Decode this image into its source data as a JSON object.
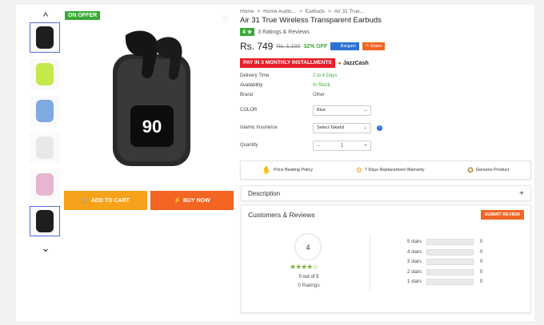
{
  "badge": "ON OFFER",
  "breadcrumb": [
    "Home",
    ">",
    "Home Audio...",
    ">",
    "Earbuds",
    ">",
    "Air 31 True..."
  ],
  "title": "Air 31 True Wireless Transparent Earbuds",
  "rating": {
    "score": "4",
    "star": "★",
    "text": "3 Ratings & Reviews"
  },
  "price": {
    "current": "Rs. 749",
    "old": "Rs. 1,100",
    "discount": "32% OFF"
  },
  "buttons": {
    "bargain": "Bargain",
    "share": "Share",
    "add_to_cart": "ADD TO CART",
    "buy_now": "BUY NOW",
    "submit_review": "SUBMIT REVIEW"
  },
  "installments": {
    "label": "PAY IN 3 MONTHLY INSTALLMENTS",
    "provider": "JazzCash"
  },
  "specs": [
    {
      "key": "Delivery Time",
      "value": "2 to 4 Days"
    },
    {
      "key": "Availability",
      "value": "In Stock"
    },
    {
      "key": "Brand",
      "value": "Other"
    }
  ],
  "fields": {
    "color_label": "COLOR",
    "color_value": "Blue",
    "insurance_label": "Islamic Insurance",
    "insurance_value": "Select Takaful",
    "qty_label": "Quantity",
    "qty_value": "1"
  },
  "features": [
    "Price Beating Policy",
    "7 Days Replacement Warranty",
    "Genuine Product"
  ],
  "description_label": "Description",
  "reviews": {
    "title": "Customers & Reviews",
    "score": "4",
    "stars": "★★★★☆",
    "out_of": "0 out of 5",
    "count": "0 Ratings",
    "rows": [
      {
        "label": "5 stars",
        "count": "0",
        "fraction": 0
      },
      {
        "label": "4 stars",
        "count": "0",
        "fraction": 0
      },
      {
        "label": "3 stars",
        "count": "0",
        "fraction": 0
      },
      {
        "label": "2 stars",
        "count": "0",
        "fraction": 0
      },
      {
        "label": "1 stars",
        "count": "0",
        "fraction": 0
      }
    ]
  },
  "screen_text": {
    "display": "90"
  },
  "colors": {
    "green": "#3aaa35",
    "orange": "#f26522",
    "yellow": "#f7a21b",
    "blue": "#2d71d4"
  },
  "thumbnail_colors": [
    "#1e1e1e",
    "#c5e84a",
    "#7fa9e0",
    "#e8e8e8",
    "#e6b5cf",
    "#1e1e1e"
  ]
}
